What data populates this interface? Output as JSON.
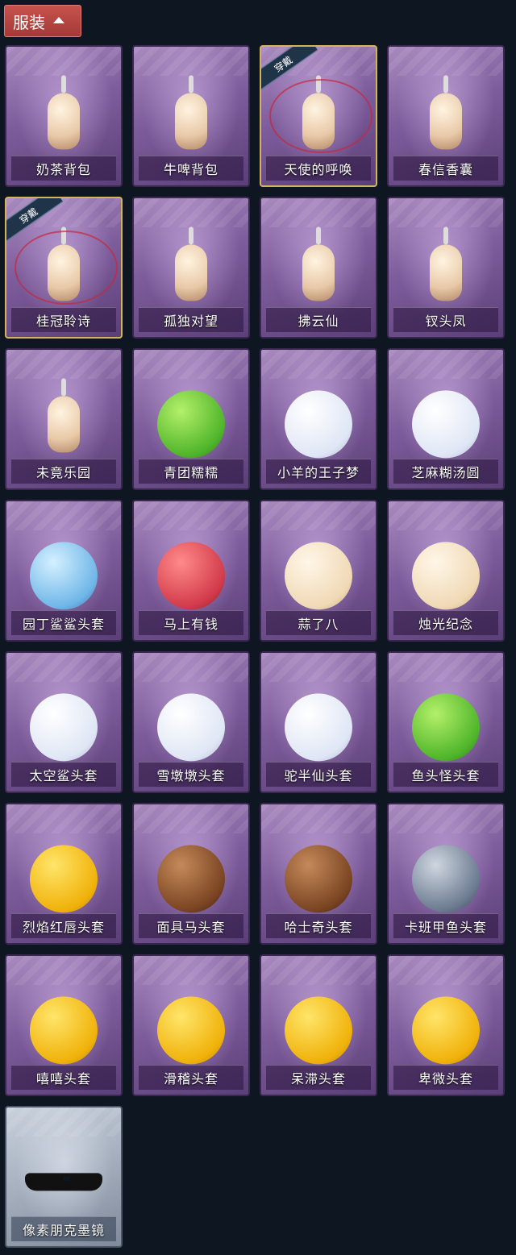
{
  "header": {
    "tab_label": "服装",
    "toggle_icon": "caret-up-icon"
  },
  "worn_badge": "穿戴",
  "items": [
    {
      "label": "奶茶背包",
      "art": "cup",
      "worn": false
    },
    {
      "label": "牛啤背包",
      "art": "barrel",
      "worn": false
    },
    {
      "label": "天使的呼唤",
      "art": "charm",
      "worn": true
    },
    {
      "label": "春信香囊",
      "art": "sachet",
      "worn": false
    },
    {
      "label": "桂冠聆诗",
      "art": "charm",
      "worn": true
    },
    {
      "label": "孤独对望",
      "art": "charm",
      "worn": false
    },
    {
      "label": "拂云仙",
      "art": "charm",
      "worn": false
    },
    {
      "label": "钗头凤",
      "art": "charm",
      "worn": false
    },
    {
      "label": "未竟乐园",
      "art": "charm",
      "worn": false
    },
    {
      "label": "青团糯糯",
      "art": "green",
      "worn": false
    },
    {
      "label": "小羊的王子梦",
      "art": "white",
      "worn": false
    },
    {
      "label": "芝麻糊汤圆",
      "art": "white",
      "worn": false
    },
    {
      "label": "园丁鲨鲨头套",
      "art": "blue",
      "worn": false
    },
    {
      "label": "马上有钱",
      "art": "red",
      "worn": false
    },
    {
      "label": "蒜了八",
      "art": "cream",
      "worn": false
    },
    {
      "label": "烛光纪念",
      "art": "cream",
      "worn": false
    },
    {
      "label": "太空鲨头套",
      "art": "white",
      "worn": false
    },
    {
      "label": "雪墩墩头套",
      "art": "white",
      "worn": false
    },
    {
      "label": "驼半仙头套",
      "art": "white",
      "worn": false
    },
    {
      "label": "鱼头怪头套",
      "art": "green",
      "worn": false
    },
    {
      "label": "烈焰红唇头套",
      "art": "yellow",
      "worn": false
    },
    {
      "label": "面具马头套",
      "art": "brown",
      "worn": false
    },
    {
      "label": "哈士奇头套",
      "art": "brown",
      "worn": false
    },
    {
      "label": "卡班甲鱼头套",
      "art": "gray2",
      "worn": false
    },
    {
      "label": "嘻嘻头套",
      "art": "yellow-grin",
      "worn": false
    },
    {
      "label": "滑稽头套",
      "art": "yellow-smirk",
      "worn": false
    },
    {
      "label": "呆滞头套",
      "art": "yellow-stare",
      "worn": false
    },
    {
      "label": "卑微头套",
      "art": "yellow-meek",
      "worn": false
    },
    {
      "label": "像素朋克墨镜",
      "art": "shades",
      "worn": false,
      "gray": true
    }
  ]
}
